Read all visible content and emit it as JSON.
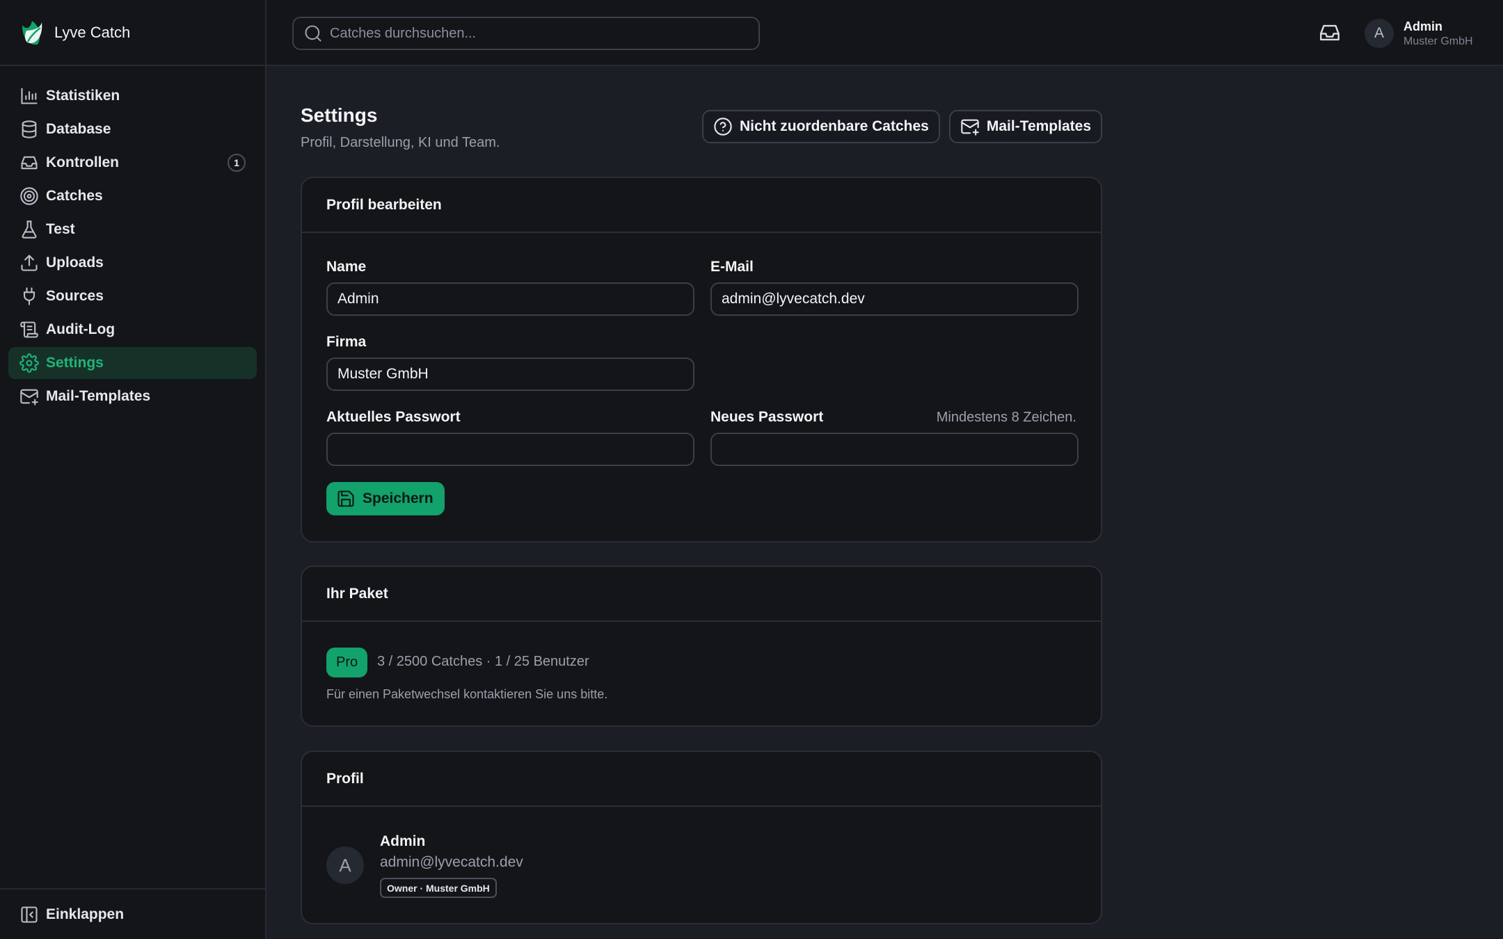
{
  "app": {
    "name": "Lyve Catch",
    "accent_color": "#13a16c"
  },
  "sidebar": {
    "items": [
      {
        "label": "Statistiken",
        "icon": "bar-chart-icon"
      },
      {
        "label": "Database",
        "icon": "database-icon"
      },
      {
        "label": "Kontrollen",
        "icon": "inbox-icon",
        "badge": "1"
      },
      {
        "label": "Catches",
        "icon": "target-icon"
      },
      {
        "label": "Test",
        "icon": "flask-icon"
      },
      {
        "label": "Uploads",
        "icon": "upload-icon"
      },
      {
        "label": "Sources",
        "icon": "plug-icon"
      },
      {
        "label": "Audit-Log",
        "icon": "scroll-icon"
      },
      {
        "label": "Settings",
        "icon": "gear-icon",
        "active": true
      },
      {
        "label": "Mail-Templates",
        "icon": "mail-plus-icon"
      }
    ],
    "collapse_label": "Einklappen"
  },
  "topbar": {
    "search_placeholder": "Catches durchsuchen...",
    "user": {
      "initial": "A",
      "name": "Admin",
      "company": "Muster GmbH"
    }
  },
  "page": {
    "title": "Settings",
    "subtitle": "Profil, Darstellung, KI und Team.",
    "actions": {
      "unassigned_label": "Nicht zuordenbare Catches",
      "mail_templates_label": "Mail-Templates"
    }
  },
  "profile_edit": {
    "title": "Profil bearbeiten",
    "name_label": "Name",
    "name_value": "Admin",
    "email_label": "E-Mail",
    "email_value": "admin@lyvecatch.dev",
    "company_label": "Firma",
    "company_value": "Muster GmbH",
    "current_password_label": "Aktuelles Passwort",
    "new_password_label": "Neues Passwort",
    "new_password_hint": "Mindestens 8 Zeichen.",
    "save_label": "Speichern"
  },
  "plan": {
    "title": "Ihr Paket",
    "badge": "Pro",
    "usage": "3 / 2500 Catches · 1 / 25 Benutzer",
    "note": "Für einen Paketwechsel kontaktieren Sie uns bitte."
  },
  "profile": {
    "title": "Profil",
    "initial": "A",
    "name": "Admin",
    "email": "admin@lyvecatch.dev",
    "role": "Owner · Muster GmbH"
  }
}
